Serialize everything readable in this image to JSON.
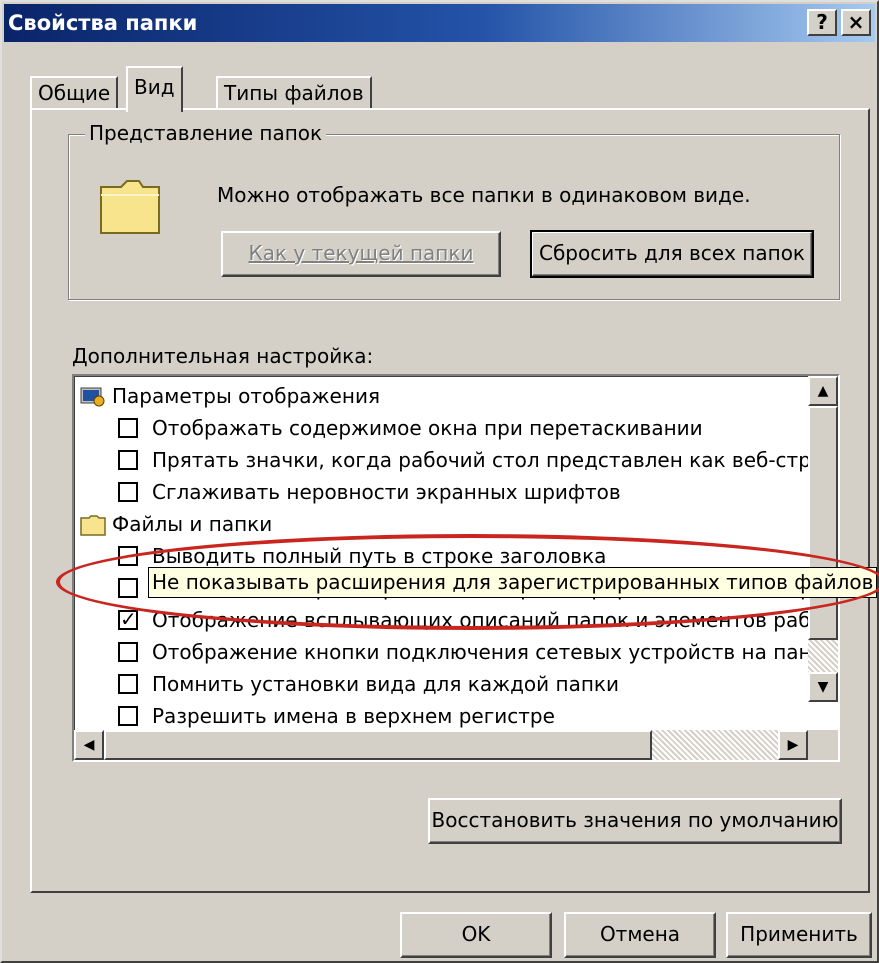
{
  "window": {
    "title": "Свойства папки",
    "help_button": "?",
    "close_button": "×"
  },
  "tabs": [
    {
      "label": "Общие",
      "active": false
    },
    {
      "label": "Вид",
      "active": true
    },
    {
      "label": "Типы файлов",
      "active": false
    }
  ],
  "folder_view": {
    "group_label": "Представление папок",
    "description": "Можно отображать все папки в одинаковом виде.",
    "like_current_button": "Как у текущей папки",
    "reset_all_button": "Сбросить для всех папок"
  },
  "advanced": {
    "label": "Дополнительная настройка:",
    "items": [
      {
        "type": "category",
        "icon": "display-settings-icon",
        "label": "Параметры отображения"
      },
      {
        "type": "checkbox",
        "checked": false,
        "label": "Отображать содержимое окна при перетаскивании"
      },
      {
        "type": "checkbox",
        "checked": false,
        "label": "Прятать значки, когда рабочий стол представлен как веб-стран"
      },
      {
        "type": "checkbox",
        "checked": false,
        "label": "Сглаживать неровности экранных шрифтов"
      },
      {
        "type": "category",
        "icon": "folder-icon",
        "label": "Файлы и папки"
      },
      {
        "type": "checkbox",
        "checked": false,
        "label": "Выводить полный путь в строке заголовка"
      },
      {
        "type": "checkbox",
        "checked": false,
        "label": "Не показывать расширения для зарегистрированных типов файлов"
      },
      {
        "type": "checkbox",
        "checked": true,
        "label": "Отображение всплывающих описаний папок и элементов рабо"
      },
      {
        "type": "checkbox",
        "checked": false,
        "label": "Отображение кнопки подключения сетевых устройств на панели"
      },
      {
        "type": "checkbox",
        "checked": false,
        "label": "Помнить установки вида для каждой папки"
      },
      {
        "type": "checkbox",
        "checked": false,
        "label": "Разрешить имена в верхнем регистре"
      }
    ],
    "tooltip": "Не показывать расширения для зарегистрированных типов файлов",
    "restore_defaults_button": "Восстановить значения по умолчанию"
  },
  "footer": {
    "ok": "OK",
    "cancel": "Отмена",
    "apply": "Применить"
  },
  "annotation_color": "#c8261e"
}
